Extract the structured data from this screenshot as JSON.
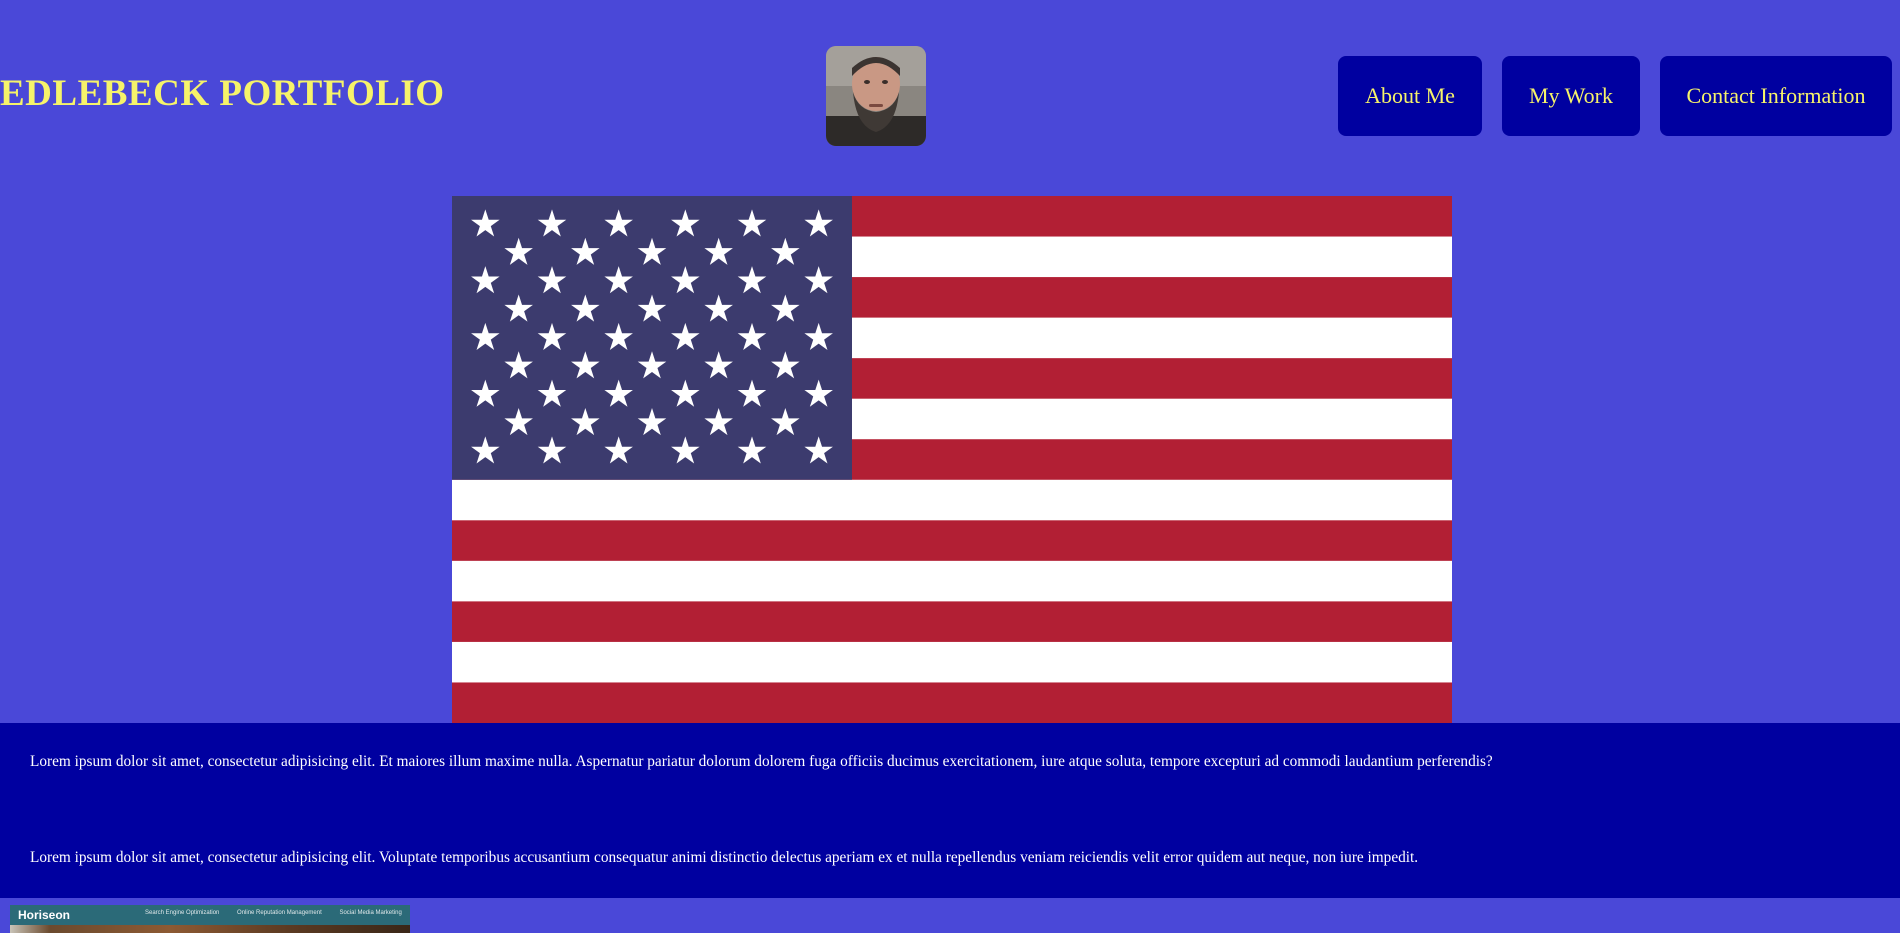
{
  "header": {
    "title": "EDLEBECK PORTFOLIO",
    "avatar_alt": "profile-photo"
  },
  "nav": {
    "items": [
      {
        "label": "About Me"
      },
      {
        "label": "My Work"
      },
      {
        "label": "Contact Information"
      }
    ]
  },
  "hero": {
    "image": "us-flag",
    "colors": {
      "field": "#3c3b6e",
      "red": "#b21f34",
      "white": "#ffffff"
    }
  },
  "about": {
    "paragraphs": [
      "Lorem ipsum dolor sit amet, consectetur adipisicing elit. Et maiores illum maxime nulla. Aspernatur pariatur dolorum dolorem fuga officiis ducimus exercitationem, iure atque soluta, tempore excepturi ad commodi laudantium perferendis?",
      "Lorem ipsum dolor sit amet, consectetur adipisicing elit. Voluptate temporibus accusantium consequatur animi distinctio delectus aperiam ex et nulla repellendus veniam reiciendis velit error quidem aut neque, non iure impedit."
    ]
  },
  "work": {
    "thumbnail": {
      "brand": "Horiseon",
      "links": [
        "Search Engine Optimization",
        "Online Reputation Management",
        "Social Media Marketing"
      ]
    }
  },
  "colors": {
    "background": "#4a48d8",
    "nav_button": "#0000a0",
    "accent_text": "#f6f36a",
    "about_bg": "#0000a0"
  }
}
